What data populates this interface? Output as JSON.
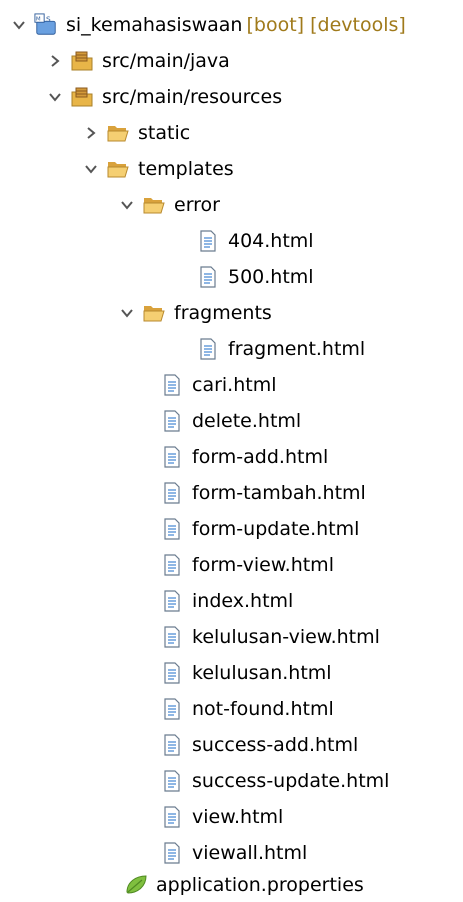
{
  "project": {
    "name": "si_kemahasiswaan",
    "decoration": "[boot] [devtools]",
    "icon": "boot-project-icon"
  },
  "tree": [
    {
      "label": "src/main/java",
      "icon": "source-folder-icon",
      "twisty": "collapsed"
    },
    {
      "label": "src/main/resources",
      "icon": "source-folder-icon",
      "twisty": "expanded"
    },
    {
      "label": "static",
      "icon": "folder-icon",
      "twisty": "collapsed"
    },
    {
      "label": "templates",
      "icon": "folder-icon",
      "twisty": "expanded"
    },
    {
      "label": "error",
      "icon": "folder-icon",
      "twisty": "expanded"
    },
    {
      "label": "404.html",
      "icon": "html-file-icon",
      "twisty": "none"
    },
    {
      "label": "500.html",
      "icon": "html-file-icon",
      "twisty": "none"
    },
    {
      "label": "fragments",
      "icon": "folder-icon",
      "twisty": "expanded"
    },
    {
      "label": "fragment.html",
      "icon": "html-file-icon",
      "twisty": "none"
    },
    {
      "label": "cari.html",
      "icon": "html-file-icon",
      "twisty": "none"
    },
    {
      "label": "delete.html",
      "icon": "html-file-icon",
      "twisty": "none"
    },
    {
      "label": "form-add.html",
      "icon": "html-file-icon",
      "twisty": "none"
    },
    {
      "label": "form-tambah.html",
      "icon": "html-file-icon",
      "twisty": "none"
    },
    {
      "label": "form-update.html",
      "icon": "html-file-icon",
      "twisty": "none"
    },
    {
      "label": "form-view.html",
      "icon": "html-file-icon",
      "twisty": "none"
    },
    {
      "label": "index.html",
      "icon": "html-file-icon",
      "twisty": "none"
    },
    {
      "label": "kelulusan-view.html",
      "icon": "html-file-icon",
      "twisty": "none"
    },
    {
      "label": "kelulusan.html",
      "icon": "html-file-icon",
      "twisty": "none"
    },
    {
      "label": "not-found.html",
      "icon": "html-file-icon",
      "twisty": "none"
    },
    {
      "label": "success-add.html",
      "icon": "html-file-icon",
      "twisty": "none"
    },
    {
      "label": "success-update.html",
      "icon": "html-file-icon",
      "twisty": "none"
    },
    {
      "label": "view.html",
      "icon": "html-file-icon",
      "twisty": "none"
    },
    {
      "label": "viewall.html",
      "icon": "html-file-icon",
      "twisty": "none"
    },
    {
      "label": "application.properties",
      "icon": "properties-file-icon",
      "twisty": "none"
    }
  ],
  "colors": {
    "decoration": "#a07a1b",
    "folder": "#e8b548",
    "twisty": "#555555"
  }
}
